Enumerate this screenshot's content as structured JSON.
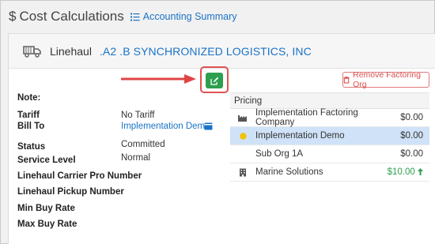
{
  "header": {
    "dollar_symbol": "$",
    "title": "Cost Calculations",
    "accounting_link": "Accounting Summary"
  },
  "linehaul": {
    "label": "Linehaul",
    "carrier": ".A2 .B SYNCHRONIZED LOGISTICS, INC"
  },
  "details": {
    "note_label": "Note:",
    "tariff_label": "Tariff",
    "tariff_value": "No Tariff",
    "bill_to_label": "Bill To",
    "bill_to_value": "Implementation Demo",
    "status_label": "Status",
    "status_value": "Committed",
    "service_level_label": "Service Level",
    "service_level_value": "Normal",
    "carrier_pro_label": "Linehaul Carrier Pro Number",
    "pickup_number_label": "Linehaul Pickup Number",
    "min_buy_label": "Min Buy Rate",
    "max_buy_label": "Max Buy Rate"
  },
  "actions": {
    "remove_factoring": "Remove Factoring Org"
  },
  "pricing": {
    "title": "Pricing",
    "rows": [
      {
        "name": "Implementation Factoring Company",
        "amount": "$0.00",
        "icon": "factory-icon",
        "selected": false
      },
      {
        "name": "Implementation Demo",
        "amount": "$0.00",
        "icon": "star-icon",
        "selected": true
      },
      {
        "name": "Sub Org 1A",
        "amount": "$0.00",
        "icon": "",
        "selected": false
      },
      {
        "name": "Marine Solutions",
        "amount": "$10.00",
        "icon": "building-icon",
        "selected": false
      }
    ]
  },
  "colors": {
    "link": "#1a73c7",
    "success": "#2e9e4f",
    "danger": "#d9534f",
    "selected_row": "#cfe2f7"
  }
}
